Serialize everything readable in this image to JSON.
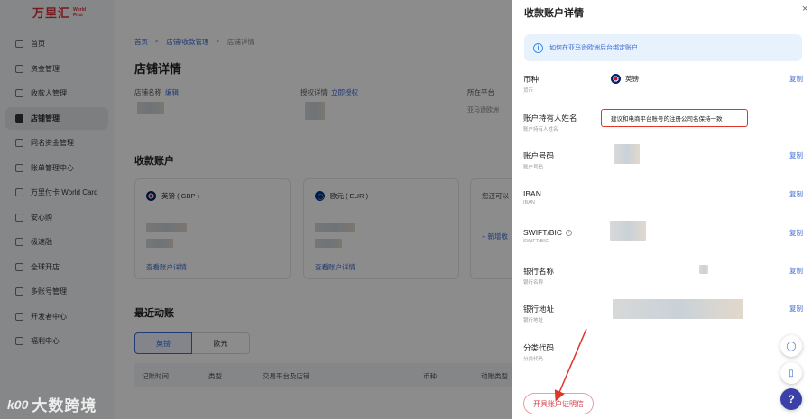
{
  "logo": {
    "cn": "万里汇",
    "en_line1": "World",
    "en_line2": "First"
  },
  "sidebar": {
    "items": [
      {
        "label": "首页"
      },
      {
        "label": "资金管理"
      },
      {
        "label": "收款人管理"
      },
      {
        "label": "店铺管理"
      },
      {
        "label": "同名资金管理"
      },
      {
        "label": "账单管理中心"
      },
      {
        "label": "万里付卡 World Card"
      },
      {
        "label": "安心购"
      },
      {
        "label": "极速融"
      },
      {
        "label": "全球开店"
      },
      {
        "label": "多账号管理"
      },
      {
        "label": "开发者中心"
      },
      {
        "label": "福利中心"
      }
    ]
  },
  "main": {
    "breadcrumb": [
      "首页",
      "店铺/收款管理",
      "店铺详情"
    ],
    "page_title": "店铺详情",
    "shop_name_label": "店铺名称",
    "edit_link": "编辑",
    "auth_label": "授权详情",
    "auth_link": "立即授权",
    "platform_label": "所在平台",
    "platform_value": "亚马逊欧洲",
    "accounts_title": "收款账户",
    "cards": [
      {
        "currency": "英镑 ( GBP )",
        "link": "查看账户详情"
      },
      {
        "currency": "欧元 ( EUR )",
        "link": "查看账户详情"
      }
    ],
    "card3_text": "您还可以",
    "card3_link": "+ 新增收",
    "recent_title": "最近动账",
    "tabs": [
      "英镑",
      "欧元"
    ],
    "table_headers": [
      "记账时间",
      "类型",
      "交易平台及店铺",
      "币种",
      "动账类型"
    ]
  },
  "watermark": {
    "logo": "k00",
    "text": "大数跨境"
  },
  "drawer": {
    "title": "收款账户详情",
    "close": "×",
    "tip": "如何在亚马逊欧洲后台绑定账户",
    "copy_label": "复制",
    "fields": [
      {
        "label": "币种",
        "sub": "货币",
        "value": "英镑",
        "copy": true
      },
      {
        "label": "账户持有人姓名",
        "sub": "账户持有人姓名",
        "copy": false
      },
      {
        "label": "账户号码",
        "sub": "账户号码",
        "copy": true
      },
      {
        "label": "IBAN",
        "sub": "IBAN",
        "copy": true
      },
      {
        "label": "SWIFT/BIC",
        "sub": "SWIFT/BIC",
        "copy": true
      },
      {
        "label": "银行名称",
        "sub": "银行名称",
        "copy": true
      },
      {
        "label": "银行地址",
        "sub": "银行地址",
        "copy": true
      },
      {
        "label": "分类代码",
        "sub": "分类代码",
        "copy": false
      }
    ],
    "holder_note": "建议和电商平台账号的注册公司名保持一致",
    "open_button": "开具账户证明信",
    "fab_help": "?"
  },
  "colors": {
    "accent": "#3b6bd6",
    "brand": "#d9303a",
    "highlight": "#e0352b",
    "help": "#3b3fa8"
  }
}
